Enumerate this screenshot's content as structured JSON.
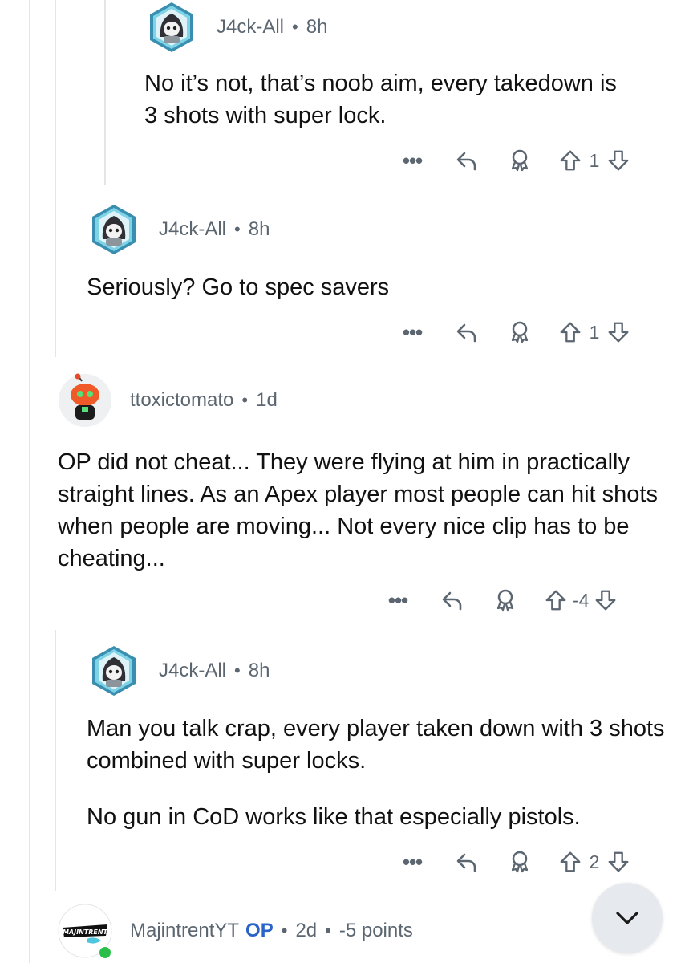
{
  "comments": [
    {
      "username": "J4ck-All",
      "age": "8h",
      "body": [
        "No it’s not, that’s noob aim, every takedown is 3 shots with super lock."
      ],
      "score": "1",
      "avatar_icon": "hooded-bot-avatar-icon"
    },
    {
      "username": "J4ck-All",
      "age": "8h",
      "body": [
        "Seriously? Go to spec savers"
      ],
      "score": "1",
      "avatar_icon": "hooded-bot-avatar-icon"
    },
    {
      "username": "ttoxictomato",
      "age": "1d",
      "body": [
        "OP did not cheat... They were flying at him in practically straight lines. As an Apex player most people can hit shots when people are moving... Not every nice clip has to be cheating..."
      ],
      "score": "-4",
      "avatar_icon": "tomato-snoo-avatar-icon"
    },
    {
      "username": "J4ck-All",
      "age": "8h",
      "body": [
        "Man you talk crap, every player taken down with 3 shots combined with super locks.",
        "No gun in CoD works like that especially pistols."
      ],
      "score": "2",
      "avatar_icon": "hooded-bot-avatar-icon"
    },
    {
      "username": "MajintrentYT",
      "op_label": "OP",
      "age": "2d",
      "points": "-5 points",
      "avatar_text": "MAJINTRENT",
      "avatar_icon": "majintrent-logo-avatar-icon"
    }
  ],
  "actions": {
    "more": "•••"
  },
  "colors": {
    "meta": "#5b6670",
    "op": "#2a63c8",
    "thread_line": "#e3e5e8",
    "fab_bg": "#e6eaef"
  },
  "scroll_button": {
    "icon": "chevron-down-icon"
  }
}
